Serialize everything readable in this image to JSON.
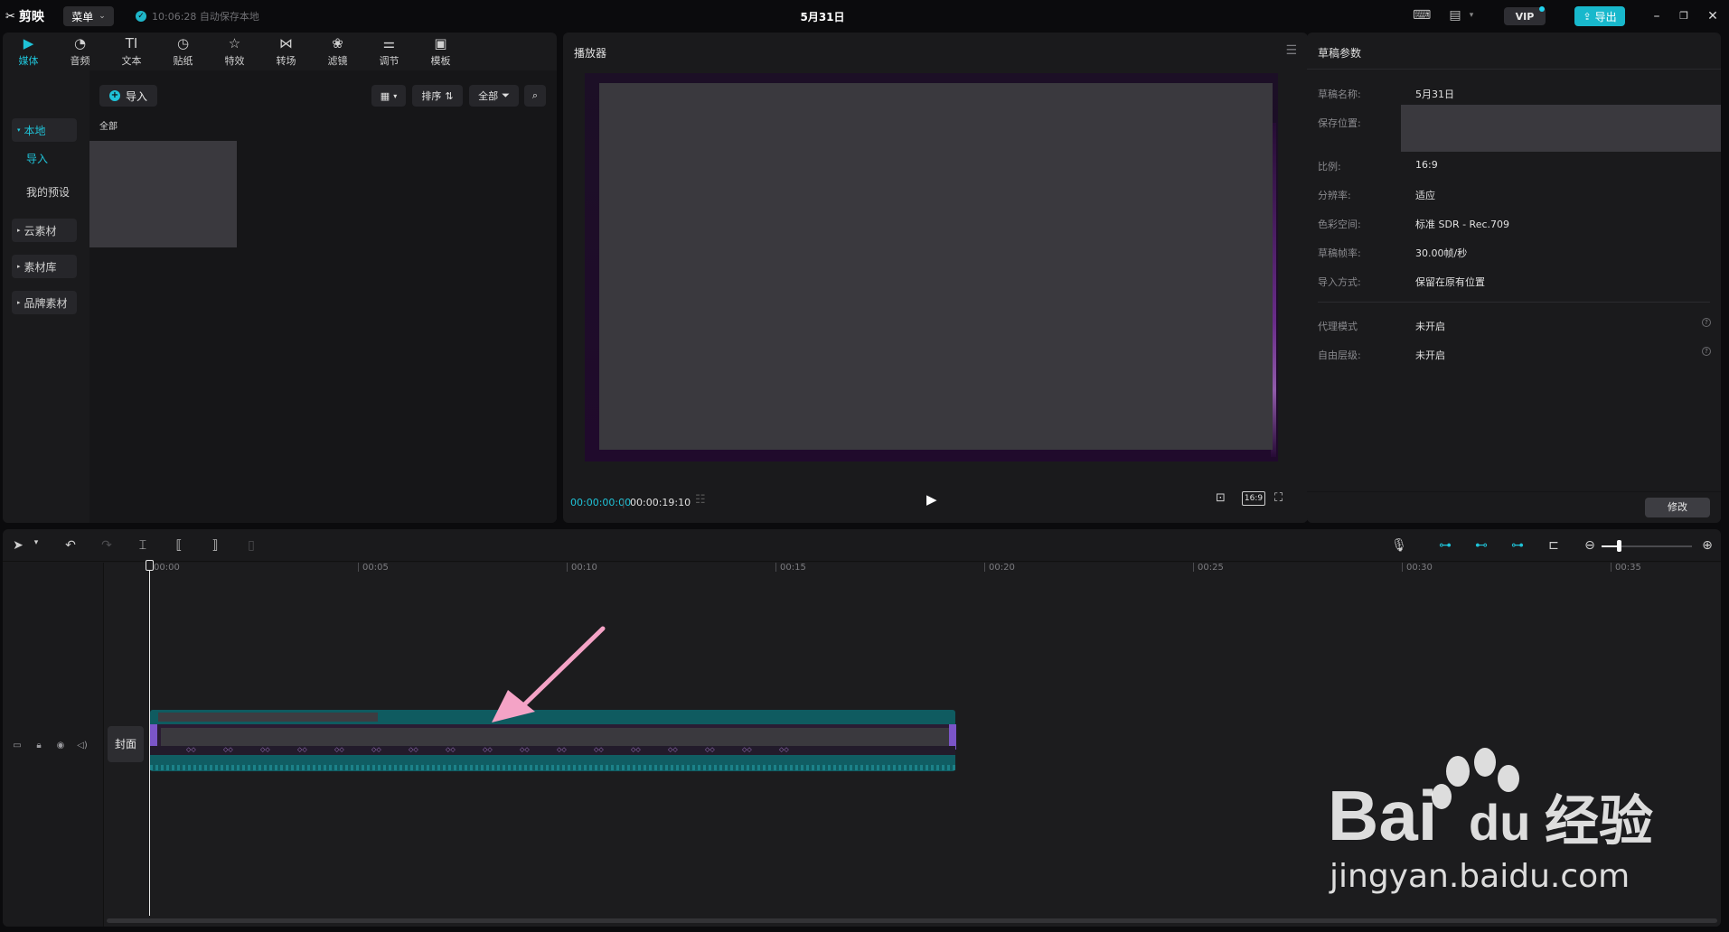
{
  "titlebar": {
    "app_name": "剪映",
    "menu_label": "菜单",
    "autosave": "10:06:28 自动保存本地",
    "doc_title": "5月31日",
    "vip": "VIP",
    "export": "导出"
  },
  "tooltabs": [
    {
      "label": "媒体",
      "icon": "media-icon",
      "glyph": "▶"
    },
    {
      "label": "音频",
      "icon": "audio-icon",
      "glyph": "◔"
    },
    {
      "label": "文本",
      "icon": "text-icon",
      "glyph": "TI"
    },
    {
      "label": "贴纸",
      "icon": "sticker-icon",
      "glyph": "◷"
    },
    {
      "label": "特效",
      "icon": "effects-icon",
      "glyph": "☆"
    },
    {
      "label": "转场",
      "icon": "transition-icon",
      "glyph": "⋈"
    },
    {
      "label": "滤镜",
      "icon": "filter-icon",
      "glyph": "❀"
    },
    {
      "label": "调节",
      "icon": "adjust-icon",
      "glyph": "⚌"
    },
    {
      "label": "模板",
      "icon": "template-icon",
      "glyph": "▣"
    }
  ],
  "media_sidebar": {
    "local": "本地",
    "import": "导入",
    "my_presets": "我的预设",
    "cloud": "云素材",
    "library": "素材库",
    "brand": "品牌素材"
  },
  "media_main": {
    "import_button": "导入",
    "sort": "排序",
    "filter_all": "全部",
    "category_all": "全部"
  },
  "player": {
    "title": "播放器",
    "current_time": "00:00:00:00",
    "total_time": "00:00:19:10",
    "ratio": "16:9"
  },
  "props": {
    "title": "草稿参数",
    "name_label": "草稿名称:",
    "name_value": "5月31日",
    "save_label": "保存位置:",
    "ratio_label": "比例:",
    "ratio_value": "16:9",
    "res_label": "分辨率:",
    "res_value": "适应",
    "color_label": "色彩空间:",
    "color_value": "标准 SDR - Rec.709",
    "fps_label": "草稿帧率:",
    "fps_value": "30.00帧/秒",
    "import_label": "导入方式:",
    "import_value": "保留在原有位置",
    "proxy_label": "代理模式",
    "proxy_value": "未开启",
    "free_label": "自由层级:",
    "free_value": "未开启",
    "modify": "修改"
  },
  "timeline": {
    "ruler": [
      "00:00",
      "00:05",
      "00:10",
      "00:15",
      "00:20",
      "00:25",
      "00:30",
      "00:35"
    ],
    "cover": "封面"
  },
  "watermark": {
    "brand": "Bai",
    "brand2": "du",
    "cn": "经验",
    "url": "jingyan.baidu.com"
  },
  "colors": {
    "accent": "#1fc3d8",
    "export_bg": "#18b8cc",
    "clip_teal": "#0f5b60",
    "clip_purple": "#7b55c8",
    "arrow_pink": "#f4a3c6"
  }
}
